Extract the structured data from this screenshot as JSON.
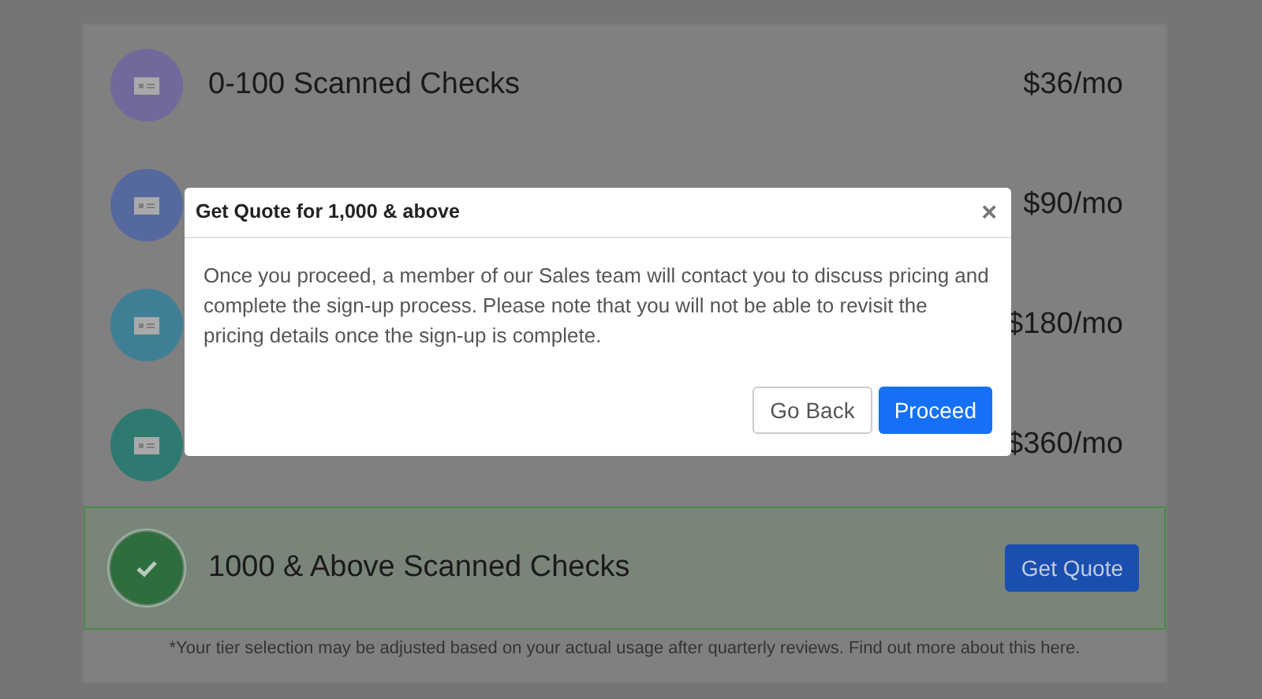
{
  "tiers": [
    {
      "label": "0-100 Scanned Checks",
      "price": "$36/mo",
      "color": "#6f6a9b",
      "selected": false
    },
    {
      "price": "$90/mo",
      "color": "#55699f",
      "selected": false
    },
    {
      "price": "$180/mo",
      "color": "#3f7f95",
      "selected": false
    },
    {
      "price": "$360/mo",
      "color": "#2f7a70",
      "selected": false
    },
    {
      "label": "1000 & Above Scanned Checks",
      "action": "Get Quote",
      "color": "#2e6e3e",
      "selected": true
    }
  ],
  "footnote": {
    "text": "*Your tier selection may be adjusted based on your actual usage after quarterly reviews. Find out more about this",
    "link": "here."
  },
  "modal": {
    "title": "Get Quote for 1,000 & above",
    "close": "×",
    "body": "Once you proceed, a member of our Sales team will contact you to discuss pricing and complete the sign-up process. Please note that you will not be able to revisit the pricing details once the sign-up is complete.",
    "buttons": [
      {
        "label": "Go Back",
        "kind": "secondary"
      },
      {
        "label": "Proceed",
        "kind": "primary"
      }
    ]
  }
}
